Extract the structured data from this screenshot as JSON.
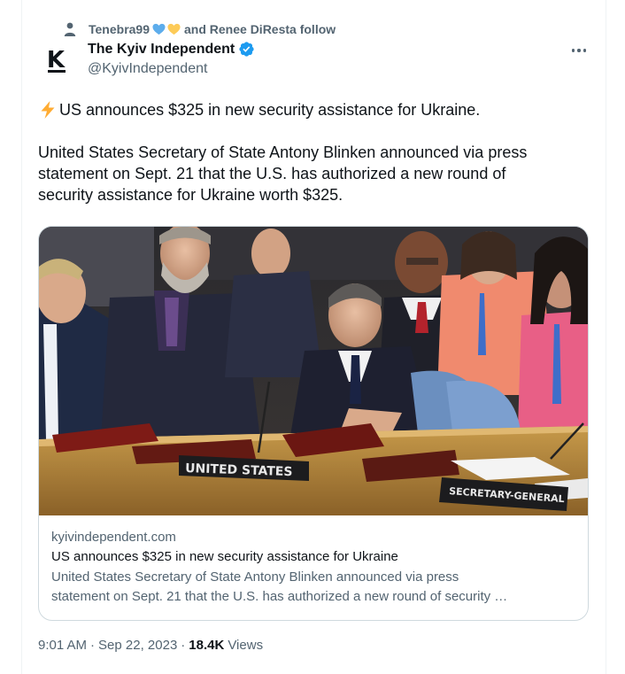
{
  "social_context": {
    "user": "Tenebra99",
    "text": "and Renee DiResta follow",
    "hearts": [
      "blue-heart",
      "yellow-heart"
    ]
  },
  "author": {
    "name": "The Kyiv Independent",
    "handle": "@KyivIndependent",
    "avatar_letter": "K",
    "verified": true
  },
  "tweet": {
    "headline": "US announces $325 in new security assistance for Ukraine.",
    "body": "United States Secretary of State Antony Blinken announced via press\nstatement on Sept. 21 that the U.S. has authorized a new round of\nsecurity assistance for Ukraine worth $325."
  },
  "card": {
    "domain": "kyivindependent.com",
    "title": "US announces $325 in new security assistance for Ukraine",
    "description": "United States Secretary of State Antony Blinken announced via press\nstatement on Sept. 21 that the U.S. has authorized a new round of security …",
    "image": {
      "nameplate_1": "UNITED STATES",
      "nameplate_2": "SECRETARY-GENERAL"
    }
  },
  "footer": {
    "time": "9:01 AM",
    "date": "Sep 22, 2023",
    "views_count": "18.4K",
    "views_label": "Views"
  },
  "colors": {
    "verified": "#1d9bf0",
    "secondary_text": "#536471",
    "primary_text": "#0f1419",
    "border": "#cfd9de"
  }
}
